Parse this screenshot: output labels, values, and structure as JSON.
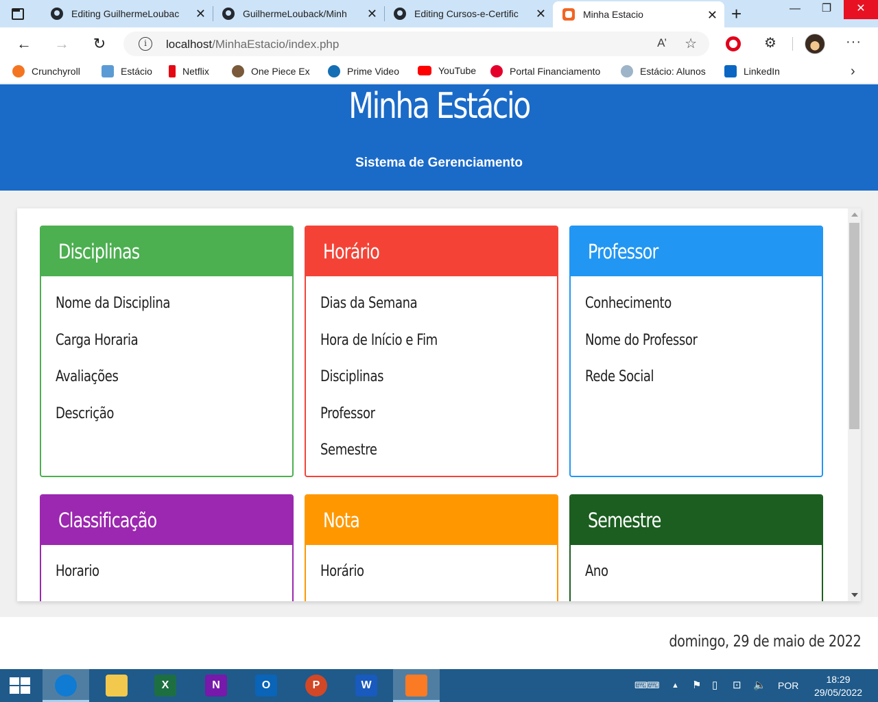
{
  "browser": {
    "tabs": [
      {
        "title": "Editing GuilhermeLoubac",
        "active": false
      },
      {
        "title": "GuilhermeLouback/Minh",
        "active": false
      },
      {
        "title": "Editing Cursos-e-Certific",
        "active": false
      },
      {
        "title": "Minha Estacio",
        "active": true
      }
    ],
    "window_controls": {
      "minimize": "—",
      "restore": "❐",
      "close": "✕"
    },
    "address": {
      "host": "localhost",
      "path": "/MinhaEstacio/index.php"
    },
    "read_aloud_label": "A’",
    "bookmarks": [
      {
        "label": "Crunchyroll",
        "color": "#f47521"
      },
      {
        "label": "Estácio",
        "color": "#5b9bd5"
      },
      {
        "label": "Netflix",
        "color": "#e50914"
      },
      {
        "label": "One Piece Ex",
        "color": "#7a5a3a"
      },
      {
        "label": "Prime Video",
        "color": "#146eb4"
      },
      {
        "label": "YouTube",
        "color": "#ff0000"
      },
      {
        "label": "Portal Financiamento",
        "color": "#e4002b"
      },
      {
        "label": "Estácio: Alunos",
        "color": "#9db4c9"
      },
      {
        "label": "LinkedIn",
        "color": "#0a66c2"
      }
    ]
  },
  "page": {
    "title": "Minha Estácio",
    "subtitle": "Sistema de Gerenciamento",
    "cards": [
      {
        "title": "Disciplinas",
        "color": "#4caf50",
        "items": [
          "Nome da Disciplina",
          "Carga Horaria",
          "Avaliações",
          "Descrição"
        ]
      },
      {
        "title": "Horário",
        "color": "#f44336",
        "items": [
          "Dias da Semana",
          "Hora de Início e Fim",
          "Disciplinas",
          "Professor",
          "Semestre"
        ]
      },
      {
        "title": "Professor",
        "color": "#2196f3",
        "items": [
          "Conhecimento",
          "Nome do Professor",
          "Rede Social"
        ]
      },
      {
        "title": "Classificação",
        "color": "#9c27b0",
        "items": [
          "Horario"
        ]
      },
      {
        "title": "Nota",
        "color": "#ff9800",
        "items": [
          "Horário"
        ]
      },
      {
        "title": "Semestre",
        "color": "#1b5e20",
        "items": [
          "Ano"
        ]
      }
    ],
    "date_text": "domingo, 29 de maio de 2022"
  },
  "taskbar": {
    "apps": [
      {
        "name": "edge",
        "label": "",
        "color": "#0f7bd3"
      },
      {
        "name": "file-explorer",
        "label": "",
        "color": "#f2c94c"
      },
      {
        "name": "excel",
        "label": "X",
        "color": "#1d6f42"
      },
      {
        "name": "onenote",
        "label": "N",
        "color": "#7719aa"
      },
      {
        "name": "outlook",
        "label": "O",
        "color": "#0a64b8"
      },
      {
        "name": "powerpoint",
        "label": "P",
        "color": "#d24726"
      },
      {
        "name": "word",
        "label": "W",
        "color": "#185abd"
      },
      {
        "name": "xampp",
        "label": "",
        "color": "#fb7a24"
      }
    ],
    "language": "POR",
    "time": "18:29",
    "date": "29/05/2022"
  }
}
